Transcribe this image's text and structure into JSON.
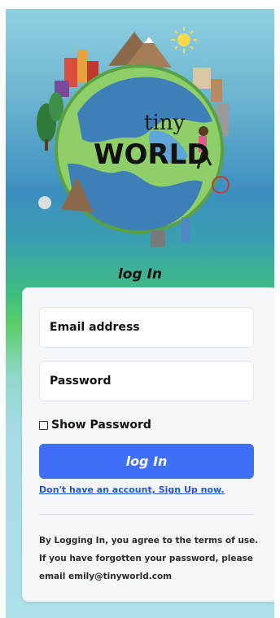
{
  "hero": {
    "logo_word_small": "tiny",
    "logo_word_big": "WORLD"
  },
  "page_title": "log In",
  "form": {
    "email_placeholder": "Email address",
    "password_placeholder": "Password",
    "show_password_label": "Show Password",
    "show_password_checked": false,
    "submit_label": "log In",
    "signup_link": "Don't have an account, Sign Up now."
  },
  "terms": {
    "line1": "By Logging In, you agree to the terms of use.",
    "line2": "If you have forgotten your password, please",
    "line3": "email emily@tinyworld.com"
  },
  "colors": {
    "accent": "#3e6ff5",
    "link": "#2554d9",
    "card": "#f4f6f9"
  }
}
